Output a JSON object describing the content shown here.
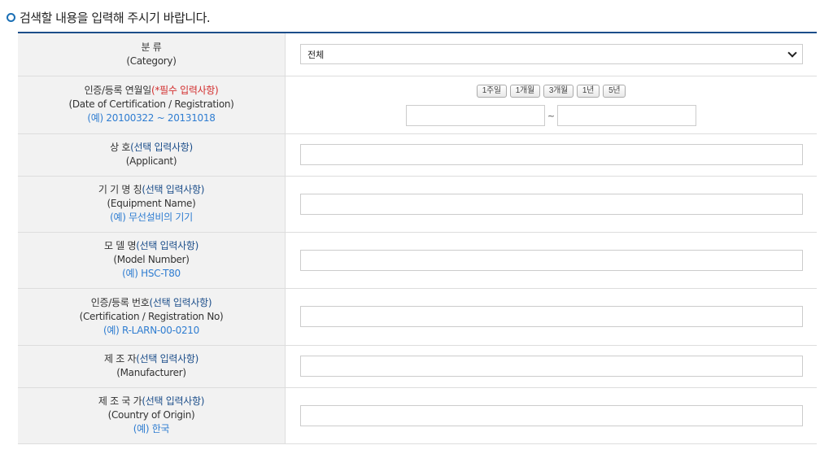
{
  "page": {
    "instruction": "검색할 내용을 입력해 주시기 바랍니다."
  },
  "rows": {
    "category": {
      "ko": "분 류",
      "en": "(Category)",
      "select_value": "전체"
    },
    "cert_date": {
      "ko": "인증/등록 연월일",
      "required": "(*필수 입력사항)",
      "en": "(Date of Certification / Registration)",
      "example": "(예) 20100322 ~ 20131018",
      "periods": [
        "1주일",
        "1개월",
        "3개월",
        "1년",
        "5년"
      ],
      "separator": "~",
      "from_value": "",
      "to_value": ""
    },
    "applicant": {
      "ko": "상 호",
      "optional": "(선택 입력사항)",
      "en": "(Applicant)",
      "value": ""
    },
    "equipment": {
      "ko": "기 기 명 칭",
      "optional": "(선택 입력사항)",
      "en": "(Equipment Name)",
      "example": "(예) 무선설비의 기기",
      "value": ""
    },
    "model": {
      "ko": "모 델 명",
      "optional": "(선택 입력사항)",
      "en": "(Model Number)",
      "example": "(예) HSC-T80",
      "value": ""
    },
    "cert_no": {
      "ko": "인증/등록 번호",
      "optional": "(선택 입력사항)",
      "en": "(Certification / Registration No)",
      "example": "(예) R-LARN-00-0210",
      "value": ""
    },
    "manufacturer": {
      "ko": "제 조 자",
      "optional": "(선택 입력사항)",
      "en": "(Manufacturer)",
      "value": ""
    },
    "country": {
      "ko": "제 조 국 가",
      "optional": "(선택 입력사항)",
      "en": "(Country of Origin)",
      "example": "(예) 한국",
      "value": ""
    }
  },
  "colors": {
    "accent": "#1c4e8a",
    "required": "#d32f2f",
    "example": "#2f7dd1",
    "label_bg": "#f2f2f2"
  }
}
